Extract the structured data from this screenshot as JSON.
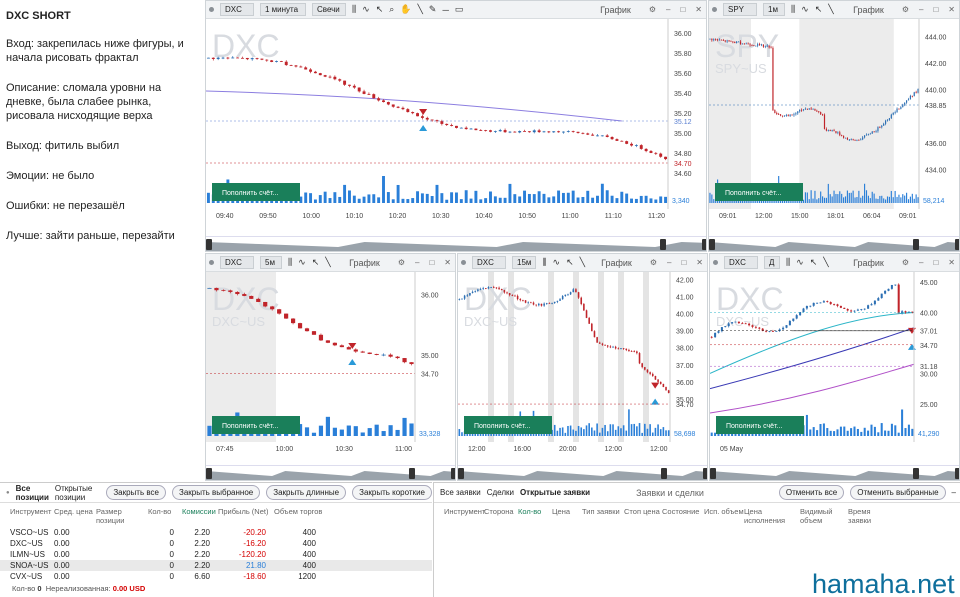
{
  "notes": {
    "title": "DXC SHORT",
    "entry": "Вход: закрепилась ниже фигуры, и начала рисовать фрактал",
    "description": "Описание: сломала уровни на дневке, была слабее рынка, рисовала нисходящие верха",
    "exit": "Выход: фитиль выбил",
    "emotions": "Эмоции: не было",
    "mistakes": "Ошибки: не перезашёл",
    "better": "Лучше: зайти раньше, перезайти"
  },
  "common": {
    "chart_label": "График",
    "fill_btn": "Пополнить счёт...",
    "candles": "Свечи"
  },
  "panels": [
    {
      "id": "dxc1m",
      "symbol": "DXC",
      "tf": "1 минута",
      "wm1": "DXC",
      "wm2": "",
      "yticks": [
        "36.00",
        "35.80",
        "35.60",
        "35.40",
        "35.20",
        "35.00",
        "34.80",
        "34.60"
      ],
      "xticks": [
        "09:40",
        "09:50",
        "10:00",
        "10:10",
        "10:20",
        "10:30",
        "10:40",
        "10:50",
        "11:00",
        "11:10",
        "11:20"
      ],
      "price1": "35.12",
      "price2": "34.70",
      "vol": "3,340"
    },
    {
      "id": "spy1m",
      "symbol": "SPY",
      "tf": "1м",
      "wm1": "SPY",
      "wm2": "SPY~US",
      "yticks": [
        "444.00",
        "442.00",
        "440.00",
        "438.85",
        "436.00",
        "434.00"
      ],
      "xticks": [
        "09:01",
        "12:00",
        "15:00",
        "18:01",
        "06:04",
        "09:01"
      ],
      "vol": "58,214"
    },
    {
      "id": "dxc5m",
      "symbol": "DXC",
      "tf": "5м",
      "wm1": "DXC",
      "wm2": "DXC~US",
      "yticks": [
        "36.00",
        "35.00",
        "34.70"
      ],
      "xticks": [
        "07:45",
        "10:00",
        "10:30",
        "11:00"
      ],
      "vol": "33,328"
    },
    {
      "id": "dxc15m",
      "symbol": "DXC",
      "tf": "15м",
      "wm1": "DXC",
      "wm2": "DXC~US",
      "yticks": [
        "42.00",
        "41.00",
        "40.00",
        "39.00",
        "38.00",
        "37.00",
        "36.00",
        "35.00",
        "34.70"
      ],
      "xticks": [
        "12:00",
        "16:00",
        "20:00",
        "12:00",
        "12:00"
      ],
      "vol": "58,698"
    },
    {
      "id": "dxcd",
      "symbol": "DXC",
      "tf": "Д",
      "wm1": "DXC",
      "wm2": "DXC~US",
      "yticks": [
        "45.00",
        "40.00",
        "37.01",
        "34.70",
        "31.18",
        "30.00",
        "25.00"
      ],
      "xticks": [
        "05 May"
      ],
      "vol": "41,290"
    }
  ],
  "positions": {
    "tabs": [
      "Все позиции",
      "Открытые позиции"
    ],
    "buttons": [
      "Закрыть все",
      "Закрыть выбранное",
      "Закрыть длинные",
      "Закрыть короткие"
    ],
    "columns": [
      "Инструмент",
      "Сред. цена",
      "Размер позиции",
      "Кол-во",
      "Комиссии",
      "Прибыль (Net)",
      "Объем торгов"
    ],
    "rows": [
      [
        "VSCO~US",
        "0.00",
        "",
        "0",
        "2.20",
        "-20.20",
        "400"
      ],
      [
        "DXC~US",
        "0.00",
        "",
        "0",
        "2.20",
        "-16.20",
        "400"
      ],
      [
        "ILMN~US",
        "0.00",
        "",
        "0",
        "2.20",
        "-120.20",
        "400"
      ],
      [
        "SNOA~US",
        "0.00",
        "",
        "0",
        "2.20",
        "21.80",
        "400"
      ],
      [
        "CVX~US",
        "0.00",
        "",
        "0",
        "6.60",
        "-18.60",
        "1200"
      ]
    ],
    "footer_qty_label": "Кол-во",
    "footer_qty": "0",
    "footer_unreal_label": "Нереализованная:",
    "footer_unreal": "0.00 USD"
  },
  "orders": {
    "tabs": [
      "Все заявки",
      "Сделки",
      "Открытые заявки"
    ],
    "title": "Заявки и сделки",
    "buttons": [
      "Отменить все",
      "Отменить выбранные"
    ],
    "columns": [
      "Инструмент",
      "Сторона",
      "Кол-во",
      "Цена",
      "Тип заявки",
      "Стоп цена",
      "Состояние",
      "Исп. объем",
      "Цена исполнения",
      "Видимый объем",
      "Время заявки"
    ]
  },
  "watermark": "hamaha.net",
  "colors": {
    "up": "#2c6fb3",
    "down": "#c0242a",
    "accent": "#1a7f5a"
  }
}
